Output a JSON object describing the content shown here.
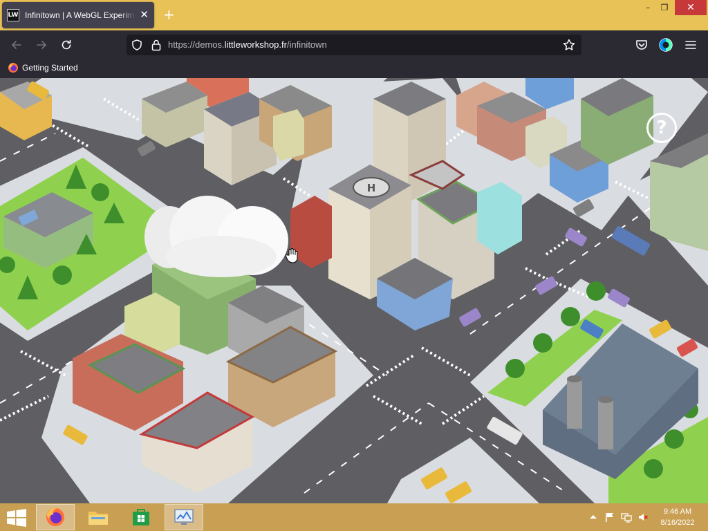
{
  "browser": {
    "tab": {
      "favicon_text": "LW",
      "title": "Infinitown | A WebGL Experiment",
      "close_symbol": "✕"
    },
    "new_tab_symbol": "+",
    "window_controls": {
      "minimize": "–",
      "maximize": "❐",
      "close": "✕"
    },
    "url": {
      "prefix": "https://demos.",
      "domain": "littleworkshop.fr",
      "path": "/infinitown"
    },
    "bookmarks": [
      {
        "label": "Getting Started"
      }
    ]
  },
  "page": {
    "help_symbol": "?"
  },
  "taskbar": {
    "time": "9:46 AM",
    "date": "8/16/2022"
  },
  "colors": {
    "titlebar": "#e8c257",
    "toolbar": "#2b2a33",
    "urlbar": "#1c1b22",
    "taskbar": "#c9a053",
    "road": "#5e5e63",
    "sidewalk": "#d9dce0",
    "grass": "#8fd14f"
  }
}
